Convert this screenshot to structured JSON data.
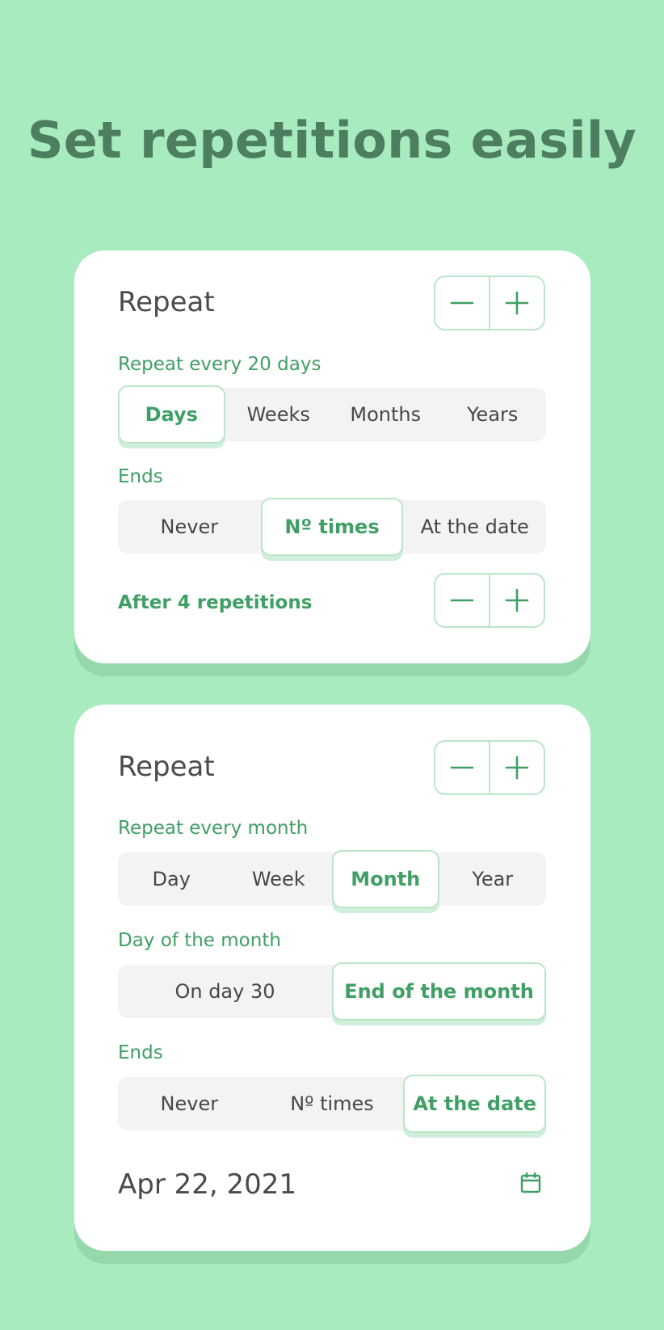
{
  "headline": "Set repetitions easily",
  "accent_color": "#3f9f64",
  "background_color": "#a7ebbf",
  "card1": {
    "title": "Repeat",
    "stepper": {
      "minus_icon": "minus-icon",
      "plus_icon": "plus-icon"
    },
    "repeat_label": "Repeat every 20 days",
    "units": [
      {
        "label": "Days",
        "active": true
      },
      {
        "label": "Weeks",
        "active": false
      },
      {
        "label": "Months",
        "active": false
      },
      {
        "label": "Years",
        "active": false
      }
    ],
    "ends_label": "Ends",
    "ends_options": [
      {
        "label": "Never",
        "active": false
      },
      {
        "label": "Nº times",
        "active": true
      },
      {
        "label": "At the date",
        "active": false
      }
    ],
    "after_label": "After 4 repetitions"
  },
  "card2": {
    "title": "Repeat",
    "stepper": {
      "minus_icon": "minus-icon",
      "plus_icon": "plus-icon"
    },
    "repeat_label": "Repeat every month",
    "units": [
      {
        "label": "Day",
        "active": false
      },
      {
        "label": "Week",
        "active": false
      },
      {
        "label": "Month",
        "active": true
      },
      {
        "label": "Year",
        "active": false
      }
    ],
    "day_label": "Day of the month",
    "day_options": [
      {
        "label": "On day 30",
        "active": false
      },
      {
        "label": "End of the month",
        "active": true
      }
    ],
    "ends_label": "Ends",
    "ends_options": [
      {
        "label": "Never",
        "active": false
      },
      {
        "label": "Nº times",
        "active": false
      },
      {
        "label": "At the date",
        "active": true
      }
    ],
    "date_value": "Apr 22, 2021",
    "date_icon": "calendar-icon"
  }
}
